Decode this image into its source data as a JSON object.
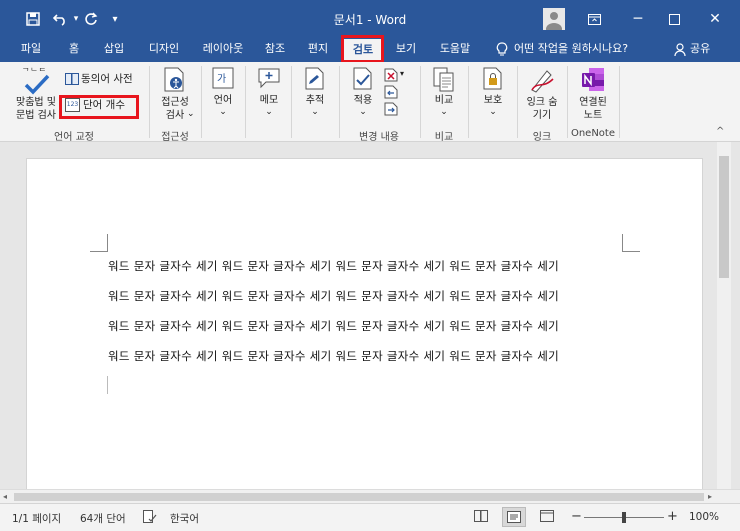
{
  "window": {
    "title": "문서1 - Word",
    "minimize_glyph": "─",
    "restore_glyph": "☐",
    "close_glyph": "✕",
    "ribbon_display_glyph": "▭"
  },
  "quick_access": {
    "save_icon": "save-icon",
    "undo_icon": "undo-icon",
    "redo_icon": "redo-icon",
    "customize_glyph": "▾"
  },
  "tabs": [
    {
      "label": "파일"
    },
    {
      "label": "홈"
    },
    {
      "label": "삽입"
    },
    {
      "label": "디자인"
    },
    {
      "label": "레이아웃"
    },
    {
      "label": "참조"
    },
    {
      "label": "편지"
    },
    {
      "label": "검토",
      "active": true
    },
    {
      "label": "보기"
    },
    {
      "label": "도움말"
    }
  ],
  "tell_me": "어떤 작업을 원하시나요?",
  "share": "공유",
  "ribbon": {
    "proofing": {
      "spelling_label_1": "맞춤법 및",
      "spelling_label_2": "문법 검사",
      "spelling_icon_text": "ᄀᄂᄃ",
      "thesaurus": "동의어 사전",
      "word_count": "단어 개수",
      "word_count_icon_text": "123",
      "group": "언어 교정"
    },
    "accessibility": {
      "check_label_1": "접근성",
      "check_label_2": "검사",
      "group": "접근성"
    },
    "language": {
      "label": "언어"
    },
    "comments": {
      "label": "메모"
    },
    "tracking": {
      "label": "추적"
    },
    "changes": {
      "accept": "적용",
      "group": "변경 내용"
    },
    "compare": {
      "label": "비교",
      "group": "비교"
    },
    "protect": {
      "label": "보호"
    },
    "ink": {
      "label_1": "잉크 숨",
      "label_2": "기기",
      "group": "잉크"
    },
    "onenote": {
      "label_1": "연결된",
      "label_2": "노트",
      "group": "OneNote"
    },
    "dropdown_glyph": "⌄",
    "collapse_glyph": "^"
  },
  "document": {
    "lines": [
      "워드 문자 글자수 세기 워드 문자 글자수 세기 워드 문자 글자수 세기 워드 문자 글자수 세기",
      "워드 문자 글자수 세기 워드 문자 글자수 세기 워드 문자 글자수 세기 워드 문자 글자수 세기",
      "워드 문자 글자수 세기 워드 문자 글자수 세기 워드 문자 글자수 세기 워드 문자 글자수 세기",
      "워드 문자 글자수 세기 워드 문자 글자수 세기 워드 문자 글자수 세기 워드 문자 글자수 세기"
    ]
  },
  "statusbar": {
    "page": "1/1 페이지",
    "words": "64개 단어",
    "language": "한국어",
    "zoom": "100%",
    "zoom_minus": "−",
    "zoom_plus": "+"
  },
  "colors": {
    "accent": "#2b579a",
    "highlight": "#e8151d"
  }
}
